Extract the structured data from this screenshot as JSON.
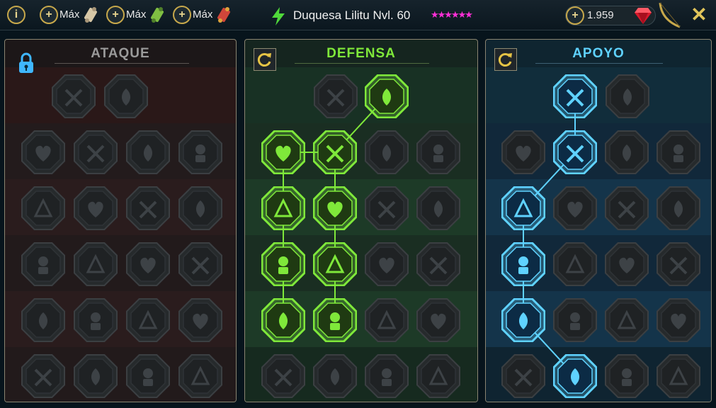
{
  "header": {
    "info_label": "i",
    "max_buttons": [
      {
        "label": "Máx",
        "scroll_color": "#d6c7a6"
      },
      {
        "label": "Máx",
        "scroll_color": "#7fbf42"
      },
      {
        "label": "Máx",
        "scroll_color": "#d0463a"
      }
    ],
    "champion_title": "Duquesa Lilitu Nvl. 60",
    "stars": "★★★★★★",
    "gems_value": "1.959",
    "close_label": "✕"
  },
  "panels": [
    {
      "key": "attack",
      "title": "ATAQUE",
      "accent": "#9a9a9a",
      "locked": true,
      "columns": 4,
      "rows": [
        [
          "crossed-swords",
          "daggers"
        ],
        [
          "demon-figure",
          "curtain",
          "shield-strike",
          "bleeding-heart"
        ],
        [
          "kneeling-figure",
          "fanged-maw",
          "skull-sword",
          "arm-strike"
        ],
        [
          "heart-sword",
          "fist-block",
          "axe",
          "chain-lightning"
        ],
        [
          "exploding-strike",
          "skull",
          "bleeding-sword",
          "strong-man"
        ],
        [
          "sword-burst",
          "helmet",
          "winged-skull",
          "skull-poison"
        ]
      ],
      "active": [],
      "links": []
    },
    {
      "key": "defense",
      "title": "DEFENSA",
      "accent": "#7fe83a",
      "locked": false,
      "columns": 4,
      "rows": [
        [
          "brick-wall",
          "raised-fist"
        ],
        [
          "chevron-shield",
          "heart-armor",
          "ogre",
          "broken-sword"
        ],
        [
          "kick-fighter",
          "shield-knight",
          "poison-skull",
          "orb-face"
        ],
        [
          "crowd",
          "hourglass-skull",
          "hand-print",
          "bull-head"
        ],
        [
          "speed-runner",
          "triple-spikes",
          "skull-ring",
          "comet"
        ],
        [
          "horned-demon",
          "shield-wing",
          "helmet-skull",
          "dancer"
        ]
      ],
      "active": [
        [
          0,
          1
        ],
        [
          1,
          0
        ],
        [
          1,
          1
        ],
        [
          2,
          0
        ],
        [
          2,
          1
        ],
        [
          3,
          0
        ],
        [
          3,
          1
        ],
        [
          4,
          0
        ],
        [
          4,
          1
        ]
      ],
      "links": [
        [
          [
            0,
            1
          ],
          [
            1,
            1
          ]
        ],
        [
          [
            1,
            0
          ],
          [
            1,
            1
          ]
        ],
        [
          [
            1,
            0
          ],
          [
            2,
            0
          ]
        ],
        [
          [
            1,
            1
          ],
          [
            2,
            1
          ]
        ],
        [
          [
            2,
            0
          ],
          [
            3,
            0
          ]
        ],
        [
          [
            2,
            1
          ],
          [
            3,
            1
          ]
        ],
        [
          [
            3,
            0
          ],
          [
            4,
            0
          ]
        ],
        [
          [
            3,
            1
          ],
          [
            4,
            1
          ]
        ]
      ]
    },
    {
      "key": "support",
      "title": "APOYO",
      "accent": "#5fd2ff",
      "locked": false,
      "columns": 4,
      "rows": [
        [
          "heart-plus",
          "arrow-burst"
        ],
        [
          "praying-hands",
          "spiral-shield",
          "flame-skull",
          "fast-arrows"
        ],
        [
          "healer-figure",
          "lightning-octagon",
          "running-legs",
          "statue"
        ],
        [
          "chained-heart",
          "meteor",
          "open-book",
          "angry-face"
        ],
        [
          "compass-star",
          "fast-boot",
          "eye",
          "dancing-figure"
        ],
        [
          "potion-skull",
          "horned-skull",
          "fist-grip",
          "eagle-head"
        ]
      ],
      "active": [
        [
          0,
          0
        ],
        [
          1,
          1
        ],
        [
          2,
          0
        ],
        [
          3,
          0
        ],
        [
          4,
          0
        ],
        [
          5,
          1
        ]
      ],
      "links": [
        [
          [
            0,
            0
          ],
          [
            1,
            1
          ]
        ],
        [
          [
            1,
            1
          ],
          [
            2,
            0
          ]
        ],
        [
          [
            2,
            0
          ],
          [
            3,
            0
          ]
        ],
        [
          [
            3,
            0
          ],
          [
            4,
            0
          ]
        ],
        [
          [
            4,
            0
          ],
          [
            5,
            1
          ]
        ]
      ]
    }
  ]
}
